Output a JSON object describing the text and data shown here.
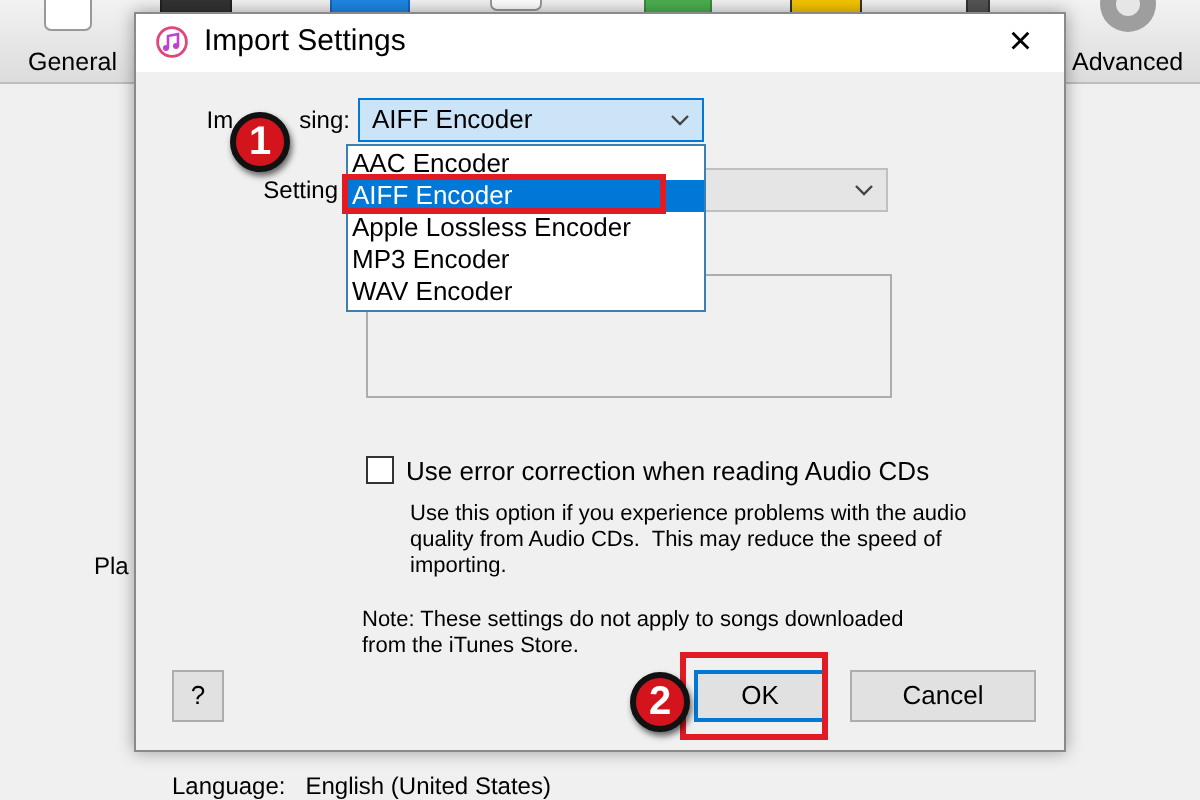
{
  "background": {
    "toolbar": [
      {
        "label": "General"
      },
      {
        "label": "Advanced"
      }
    ],
    "side_text": "Pla",
    "language": {
      "label": "Language:",
      "value": "English (United States)"
    }
  },
  "dialog": {
    "title": "Import Settings",
    "close": "×",
    "import_using": {
      "label_parts": [
        "Im",
        "sing:"
      ],
      "value": "AIFF Encoder",
      "expanded": true,
      "options": [
        {
          "label": "AAC Encoder",
          "selected": false
        },
        {
          "label": "AIFF Encoder",
          "selected": true
        },
        {
          "label": "Apple Lossless Encoder",
          "selected": false
        },
        {
          "label": "MP3 Encoder",
          "selected": false
        },
        {
          "label": "WAV Encoder",
          "selected": false
        }
      ]
    },
    "setting": {
      "label": "Setting",
      "disabled": true
    },
    "error_correction": {
      "label": "Use error correction when reading Audio CDs",
      "checked": false,
      "description": "Use this option if you experience problems with the audio quality from Audio CDs.  This may reduce the speed of importing."
    },
    "note": "Note: These settings do not apply to songs downloaded from the iTunes Store.",
    "buttons": [
      {
        "label": "?",
        "kind": "help"
      },
      {
        "label": "OK",
        "kind": "default"
      },
      {
        "label": "Cancel",
        "kind": "normal"
      }
    ]
  },
  "annotations": [
    {
      "label": "1"
    },
    {
      "label": "2"
    }
  ]
}
